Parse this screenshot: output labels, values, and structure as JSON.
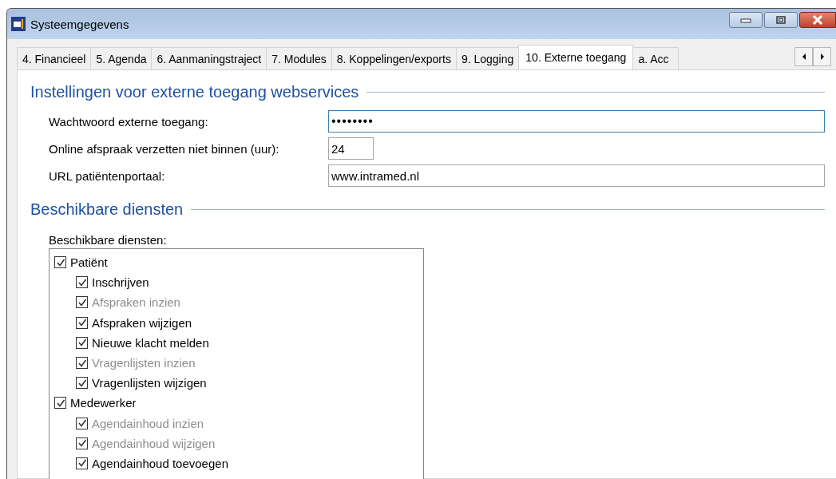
{
  "window": {
    "title": "Systeemgegevens"
  },
  "tabs": [
    {
      "label": "4. Financieel",
      "selected": false
    },
    {
      "label": "5. Agenda",
      "selected": false
    },
    {
      "label": "6. Aanmaningstraject",
      "selected": false
    },
    {
      "label": "7. Modules",
      "selected": false
    },
    {
      "label": "8. Koppelingen/exports",
      "selected": false
    },
    {
      "label": "9. Logging",
      "selected": false
    },
    {
      "label": "10. Externe toegang",
      "selected": true
    },
    {
      "label": "a. Acc",
      "selected": false
    }
  ],
  "settings": {
    "heading": "Instellingen voor externe toegang webservices",
    "fields": [
      {
        "label": "Wachtwoord externe toegang:",
        "value": "••••••••",
        "kind": "password",
        "focused": true
      },
      {
        "label": "Online afspraak verzetten niet binnen (uur):",
        "value": "24",
        "kind": "short",
        "focused": false
      },
      {
        "label": "URL patiëntenportaal:",
        "value": "www.intramed.nl",
        "kind": "wide",
        "focused": false
      }
    ]
  },
  "services": {
    "heading": "Beschikbare diensten",
    "list_label": "Beschikbare diensten:",
    "tree": [
      {
        "label": "Patiënt",
        "checked": true,
        "disabled": false,
        "children": [
          {
            "label": "Inschrijven",
            "checked": true,
            "disabled": false
          },
          {
            "label": "Afspraken inzien",
            "checked": true,
            "disabled": true
          },
          {
            "label": "Afspraken wijzigen",
            "checked": true,
            "disabled": false
          },
          {
            "label": "Nieuwe klacht melden",
            "checked": true,
            "disabled": false
          },
          {
            "label": "Vragenlijsten inzien",
            "checked": true,
            "disabled": true
          },
          {
            "label": "Vragenlijsten wijzigen",
            "checked": true,
            "disabled": false
          }
        ]
      },
      {
        "label": "Medewerker",
        "checked": true,
        "disabled": false,
        "children": [
          {
            "label": "Agendainhoud inzien",
            "checked": true,
            "disabled": true
          },
          {
            "label": "Agendainhoud wijzigen",
            "checked": true,
            "disabled": true
          },
          {
            "label": "Agendainhoud toevoegen",
            "checked": true,
            "disabled": false
          }
        ]
      }
    ]
  }
}
